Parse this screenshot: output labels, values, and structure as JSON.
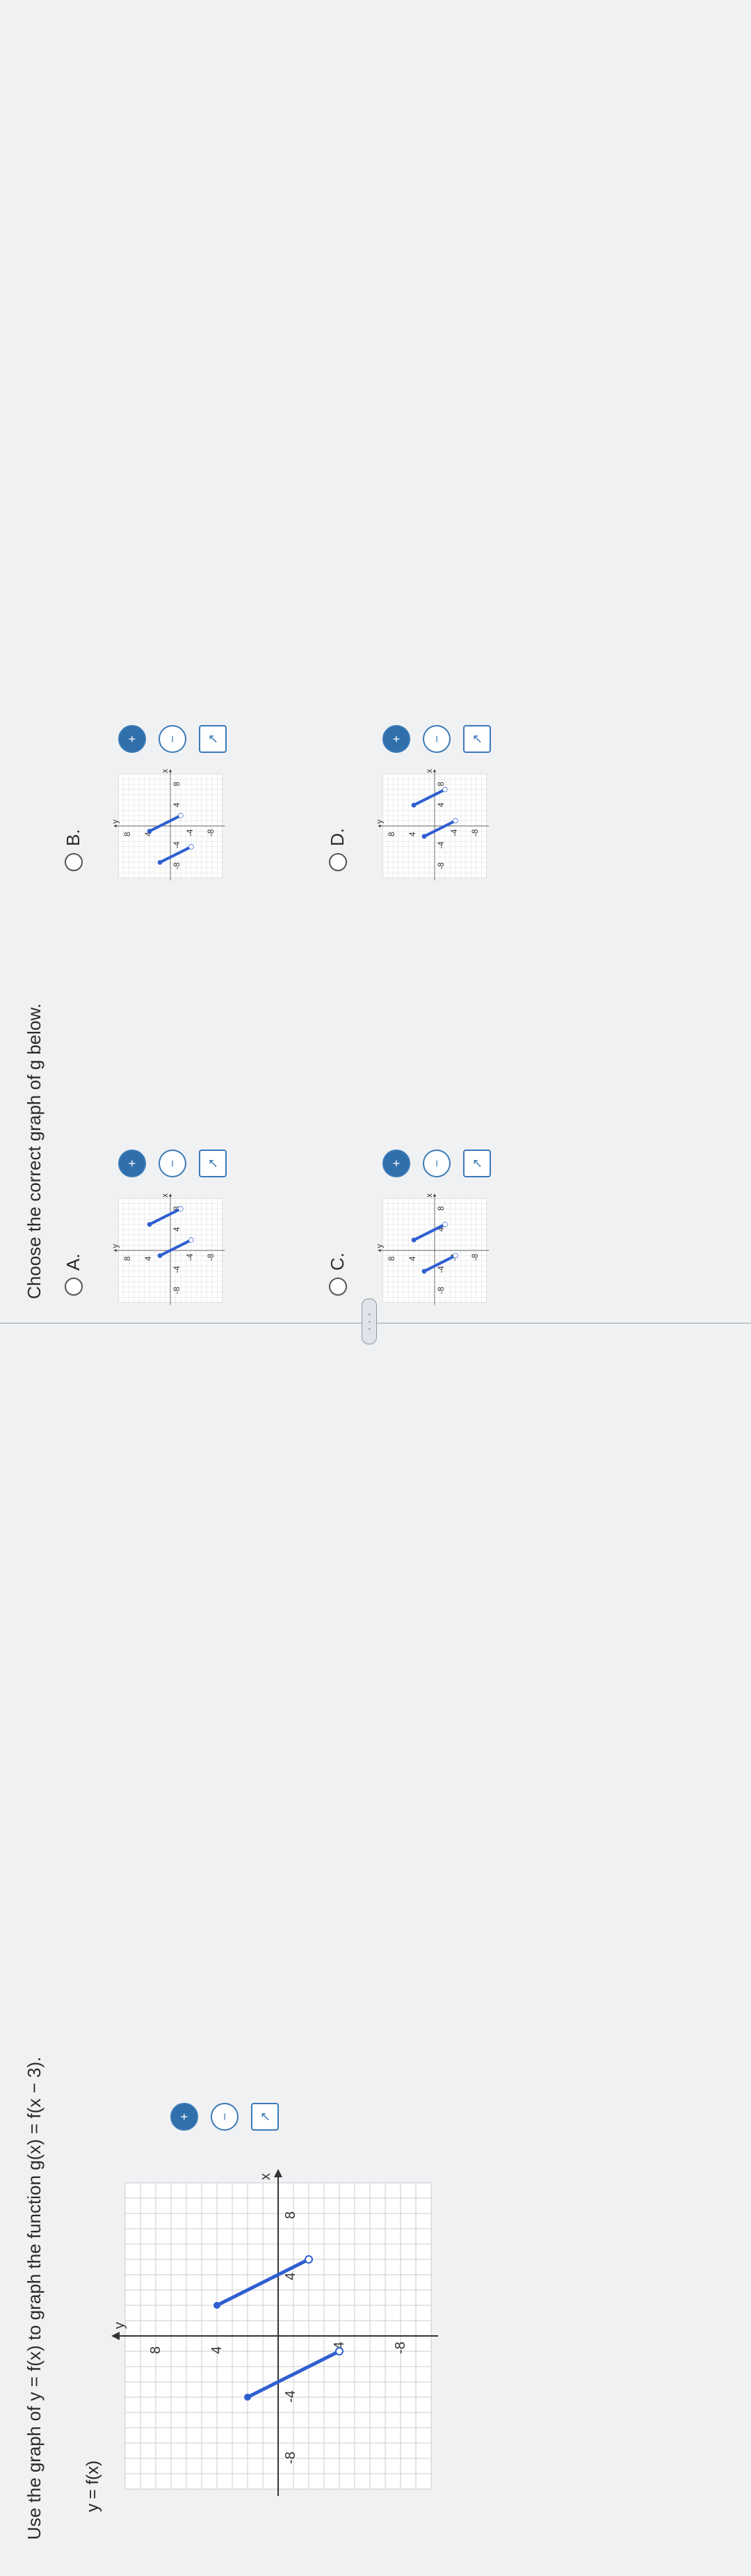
{
  "question": {
    "prompt": "Use the graph of y = f(x) to graph the function g(x) = f(x − 3).",
    "graph_label": "y = f(x)"
  },
  "answer_panel": {
    "prompt": "Choose the correct graph of g below.",
    "more_label": "· · ·",
    "options": [
      {
        "letter": "A.",
        "selected": false
      },
      {
        "letter": "B.",
        "selected": false
      },
      {
        "letter": "C.",
        "selected": false
      },
      {
        "letter": "D.",
        "selected": false
      }
    ]
  },
  "graph": {
    "axis_x": "x",
    "axis_y": "y",
    "ticks": [
      "-8",
      "-4",
      "4",
      "8"
    ],
    "segments": [
      [
        -4,
        2,
        -1,
        -4
      ],
      [
        2,
        4,
        5,
        -2
      ]
    ]
  },
  "tools": {
    "zoom_in": "zoom-in",
    "zoom_out": "zoom-out",
    "popout": "popout"
  },
  "colors": {
    "curve": "#2f5fd0",
    "grid": "#c9ccd0",
    "axis": "#333333",
    "accent": "#2f6fab"
  }
}
